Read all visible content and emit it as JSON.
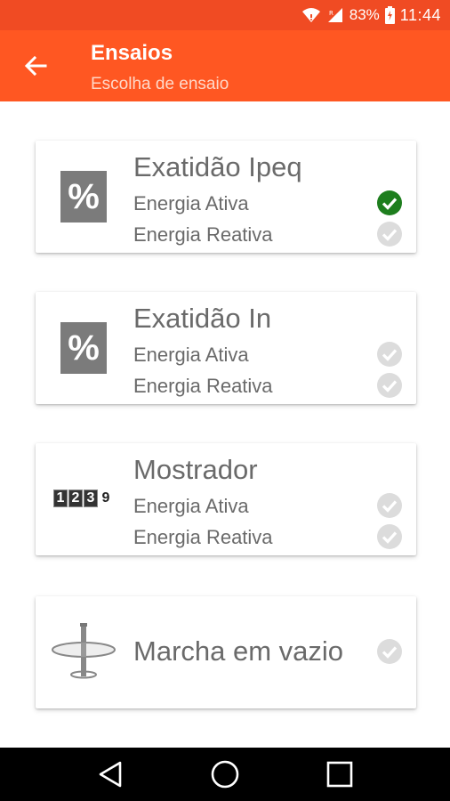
{
  "status_bar": {
    "battery_pct": "83%",
    "time": "11:44"
  },
  "app_bar": {
    "title": "Ensaios",
    "subtitle": "Escolha de ensaio"
  },
  "cards": [
    {
      "title": "Exatidão Ipeq",
      "icon": "percent-icon",
      "lines": [
        {
          "label": "Energia Ativa",
          "checked": true
        },
        {
          "label": "Energia Reativa",
          "checked": false
        }
      ]
    },
    {
      "title": "Exatidão In",
      "icon": "percent-icon",
      "lines": [
        {
          "label": "Energia Ativa",
          "checked": false
        },
        {
          "label": "Energia Reativa",
          "checked": false
        }
      ]
    },
    {
      "title": "Mostrador",
      "icon": "counter-display-icon",
      "counter_digits": [
        "1",
        "2",
        "3",
        "9"
      ],
      "lines": [
        {
          "label": "Energia Ativa",
          "checked": false
        },
        {
          "label": "Energia Reativa",
          "checked": false
        }
      ]
    },
    {
      "title": "Marcha em vazio",
      "icon": "meter-disk-icon",
      "checked": false
    }
  ],
  "colors": {
    "accent": "#ff5722",
    "status_bar": "#f04b23",
    "check_active": "#1e7e1e",
    "check_inactive": "#dcdcdc",
    "text": "#6a6a6a"
  }
}
